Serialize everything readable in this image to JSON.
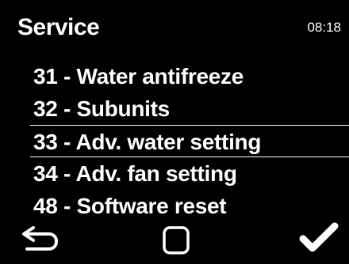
{
  "header": {
    "title": "Service",
    "time": "08:18"
  },
  "menu": {
    "items": [
      {
        "label": "31 - Water antifreeze",
        "selected": false
      },
      {
        "label": "32 - Subunits",
        "selected": false
      },
      {
        "label": "33 - Adv. water setting",
        "selected": true
      },
      {
        "label": "34 - Adv. fan setting",
        "selected": false
      },
      {
        "label": "48 - Software reset",
        "selected": false
      }
    ]
  },
  "footer": {
    "back_icon": "back-arrow-icon",
    "home_icon": "square-icon",
    "confirm_icon": "checkmark-icon"
  },
  "colors": {
    "background": "#000000",
    "foreground": "#ffffff"
  }
}
